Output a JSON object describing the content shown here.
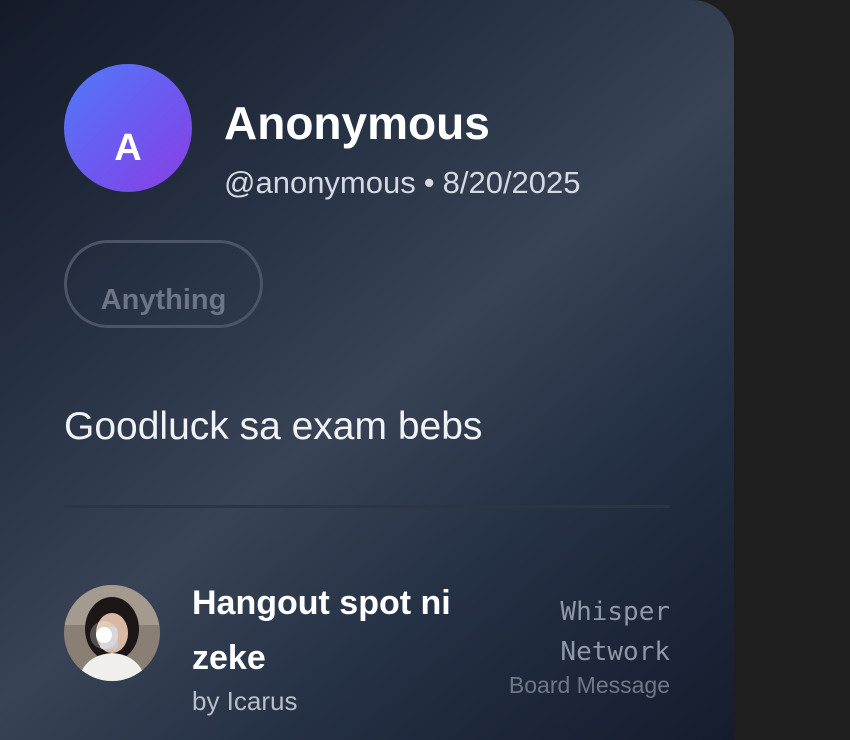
{
  "post": {
    "avatar_initial": "A",
    "author_name": "Anonymous",
    "handle": "@anonymous",
    "separator": "•",
    "date": "8/20/2025",
    "tag": "Anything",
    "message": "Goodluck sa exam bebs"
  },
  "board": {
    "title": "Hangout spot ni zeke",
    "by": "by Icarus",
    "brand": "Whisper Network",
    "kind": "Board Message"
  },
  "colors": {
    "avatar_gradient_start": "#4f7cf8",
    "avatar_gradient_end": "#8a3fe4",
    "card_dark": "#151c2d",
    "card_light": "#384355",
    "page_background": "#1e1e1e"
  }
}
